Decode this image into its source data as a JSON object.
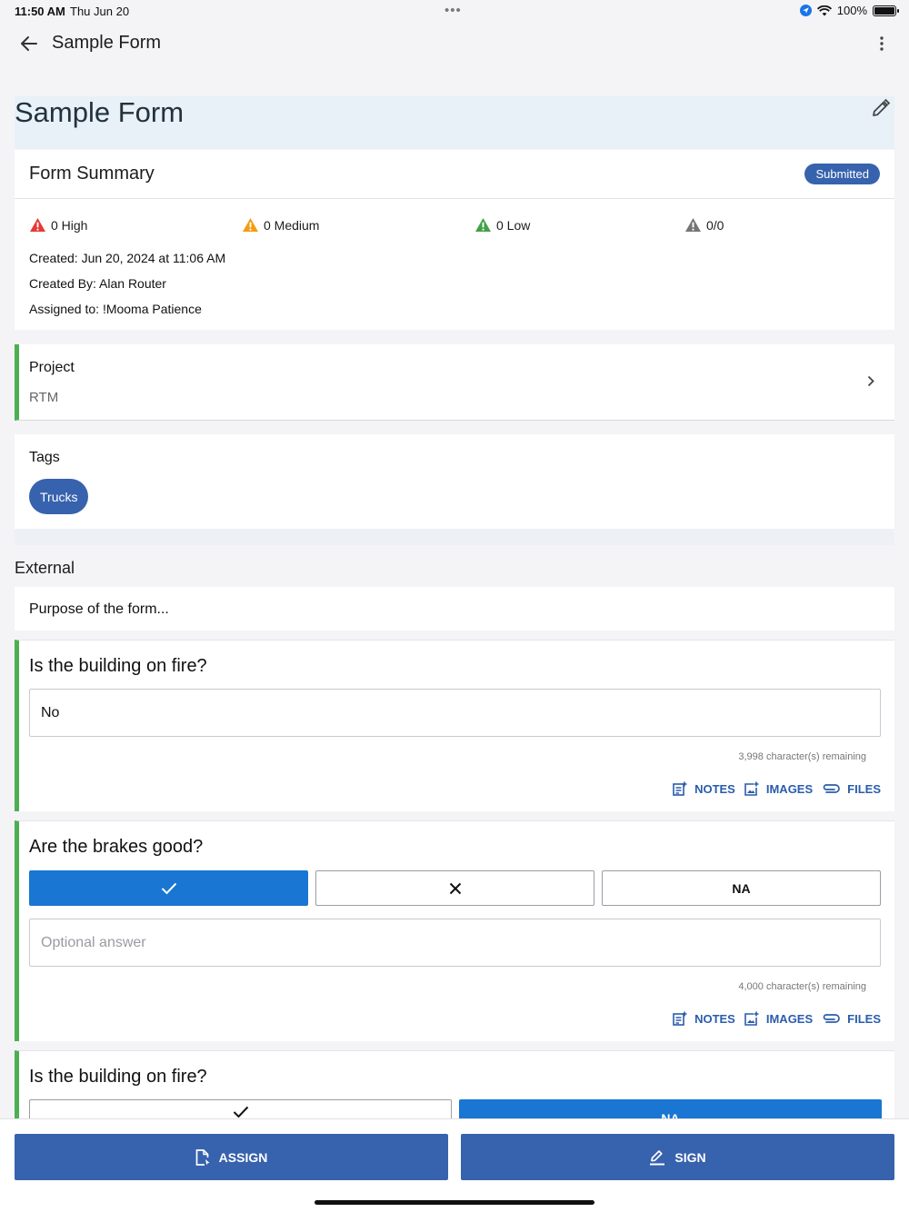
{
  "status_bar": {
    "time": "11:50 AM",
    "date": "Thu Jun 20",
    "battery": "100%"
  },
  "nav": {
    "title": "Sample Form"
  },
  "header": {
    "title": "Sample Form"
  },
  "summary": {
    "title": "Form Summary",
    "status_badge": "Submitted",
    "risks": [
      {
        "label": "0 High",
        "color": "#e53935"
      },
      {
        "label": "0 Medium",
        "color": "#f39c12"
      },
      {
        "label": "0 Low",
        "color": "#43a047"
      },
      {
        "label": "0/0",
        "color": "#757575"
      }
    ],
    "created": "Created: Jun 20, 2024 at 11:06 AM",
    "created_by": "Created By: Alan Router",
    "assigned_to": "Assigned to: !Mooma Patience"
  },
  "project": {
    "label": "Project",
    "value": "RTM"
  },
  "tags": {
    "label": "Tags",
    "items": [
      "Trucks"
    ]
  },
  "external": {
    "heading": "External",
    "purpose": "Purpose of the form..."
  },
  "questions": [
    {
      "title": "Is the building on fire?",
      "answer": "No",
      "remaining": "3,998 character(s) remaining"
    },
    {
      "title": "Are the brakes good?",
      "placeholder": "Optional answer",
      "remaining": "4,000 character(s) remaining",
      "na_label": "NA"
    },
    {
      "title": "Is the building on fire?",
      "na_label": "NA"
    }
  ],
  "actions": {
    "notes": "NOTES",
    "images": "IMAGES",
    "files": "FILES"
  },
  "bottom": {
    "assign": "ASSIGN",
    "sign": "SIGN"
  }
}
